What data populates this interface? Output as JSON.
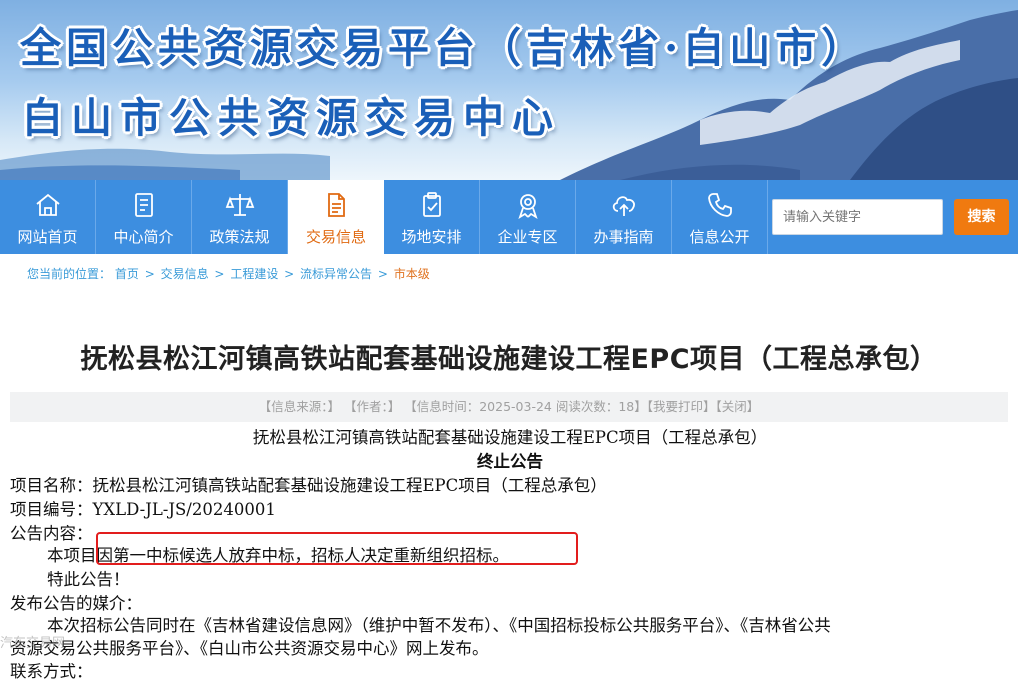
{
  "banner": {
    "line1": "全国公共资源交易平台（吉林省·白山市）",
    "line2": "白山市公共资源交易中心"
  },
  "nav": {
    "items": [
      {
        "label": "网站首页",
        "icon": "home-icon"
      },
      {
        "label": "中心简介",
        "icon": "document-list-icon"
      },
      {
        "label": "政策法规",
        "icon": "scales-icon"
      },
      {
        "label": "交易信息",
        "icon": "file-text-icon"
      },
      {
        "label": "场地安排",
        "icon": "clipboard-check-icon"
      },
      {
        "label": "企业专区",
        "icon": "award-icon"
      },
      {
        "label": "办事指南",
        "icon": "cloud-upload-icon"
      },
      {
        "label": "信息公开",
        "icon": "phone-icon"
      }
    ],
    "active_index": 3,
    "active_color": "#e06a12"
  },
  "search": {
    "placeholder": "请输入关键字",
    "button_label": "搜索",
    "button_color": "#f07a10"
  },
  "breadcrumb": {
    "prefix": "您当前的位置：",
    "items": [
      "首页",
      "交易信息",
      "工程建设",
      "流标异常公告",
      "市本级"
    ],
    "separator": ">"
  },
  "article": {
    "title": "抚松县松江河镇高铁站配套基础设施建设工程EPC项目（工程总承包）",
    "info": {
      "source": "【信息来源：】",
      "author": "【作者：】",
      "time": "【信息时间：2025-03-24 阅读次数：18】",
      "print": "【我要打印】",
      "close": "【关闭】"
    },
    "body": {
      "heading1": "抚松县松江河镇高铁站配套基础设施建设工程EPC项目（工程总承包）",
      "heading2": "终止公告",
      "project_name": "项目名称：抚松县松江河镇高铁站配套基础设施建设工程EPC项目（工程总承包）",
      "project_no": "项目编号：YXLD-JL-JS/20240001",
      "content_label": "公告内容：",
      "content_text": "本项目因第一中标候选人放弃中标，招标人决定重新组织招标。",
      "special_notice": "特此公告！",
      "media_label": "发布公告的媒介：",
      "media_text_1": "本次招标公告同时在《吉林省建设信息网》（维护中暂不发布）、《中国招标投标公共服务平台》、《吉林省公共",
      "media_text_2": "资源交易公共服务平台》、《白山市公共资源交易中心》网上发布。",
      "contact_label": "联系方式："
    }
  },
  "watermark": "汽车交易网",
  "highlight_color": "#e21d1d"
}
